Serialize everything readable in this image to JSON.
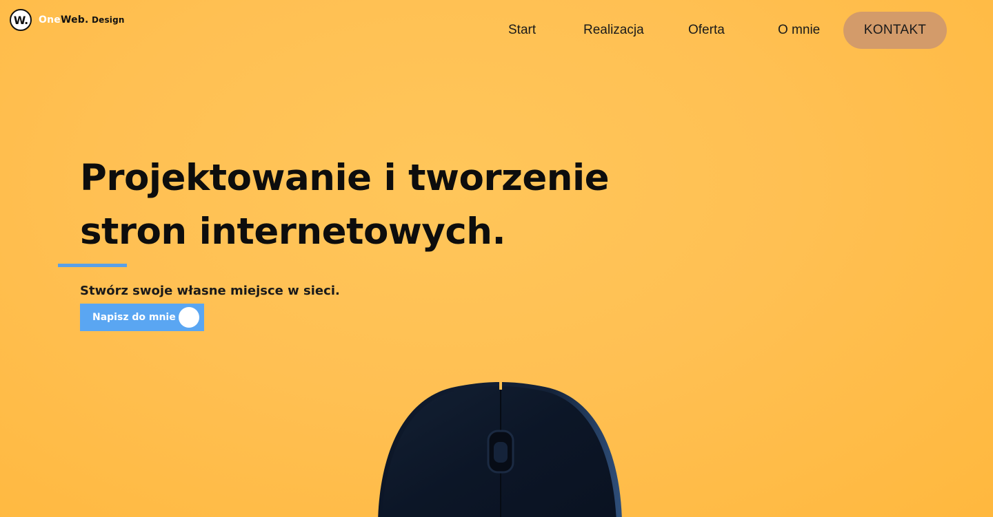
{
  "header": {
    "logo": {
      "badge": "W.",
      "name_part1": "One",
      "name_part2": "Web.",
      "name_part3": " Design"
    },
    "nav": [
      {
        "label": "Start"
      },
      {
        "label": "Realizacja"
      },
      {
        "label": "Oferta"
      },
      {
        "label": "O mnie"
      }
    ],
    "cta_label": "KONTAKT"
  },
  "hero": {
    "title_line1": "Projektowanie i tworzenie",
    "title_line2": "stron internetowych.",
    "subtitle": "Stwórz swoje własne miejsce w sieci.",
    "button_label": "Napisz do mnie"
  },
  "colors": {
    "background": "#ffc053",
    "accent_blue": "#5aa6f2",
    "cta_brown": "#d39b6a"
  },
  "icons": {
    "logo": "w-circle-logo",
    "hero_image": "computer-mouse-image"
  }
}
